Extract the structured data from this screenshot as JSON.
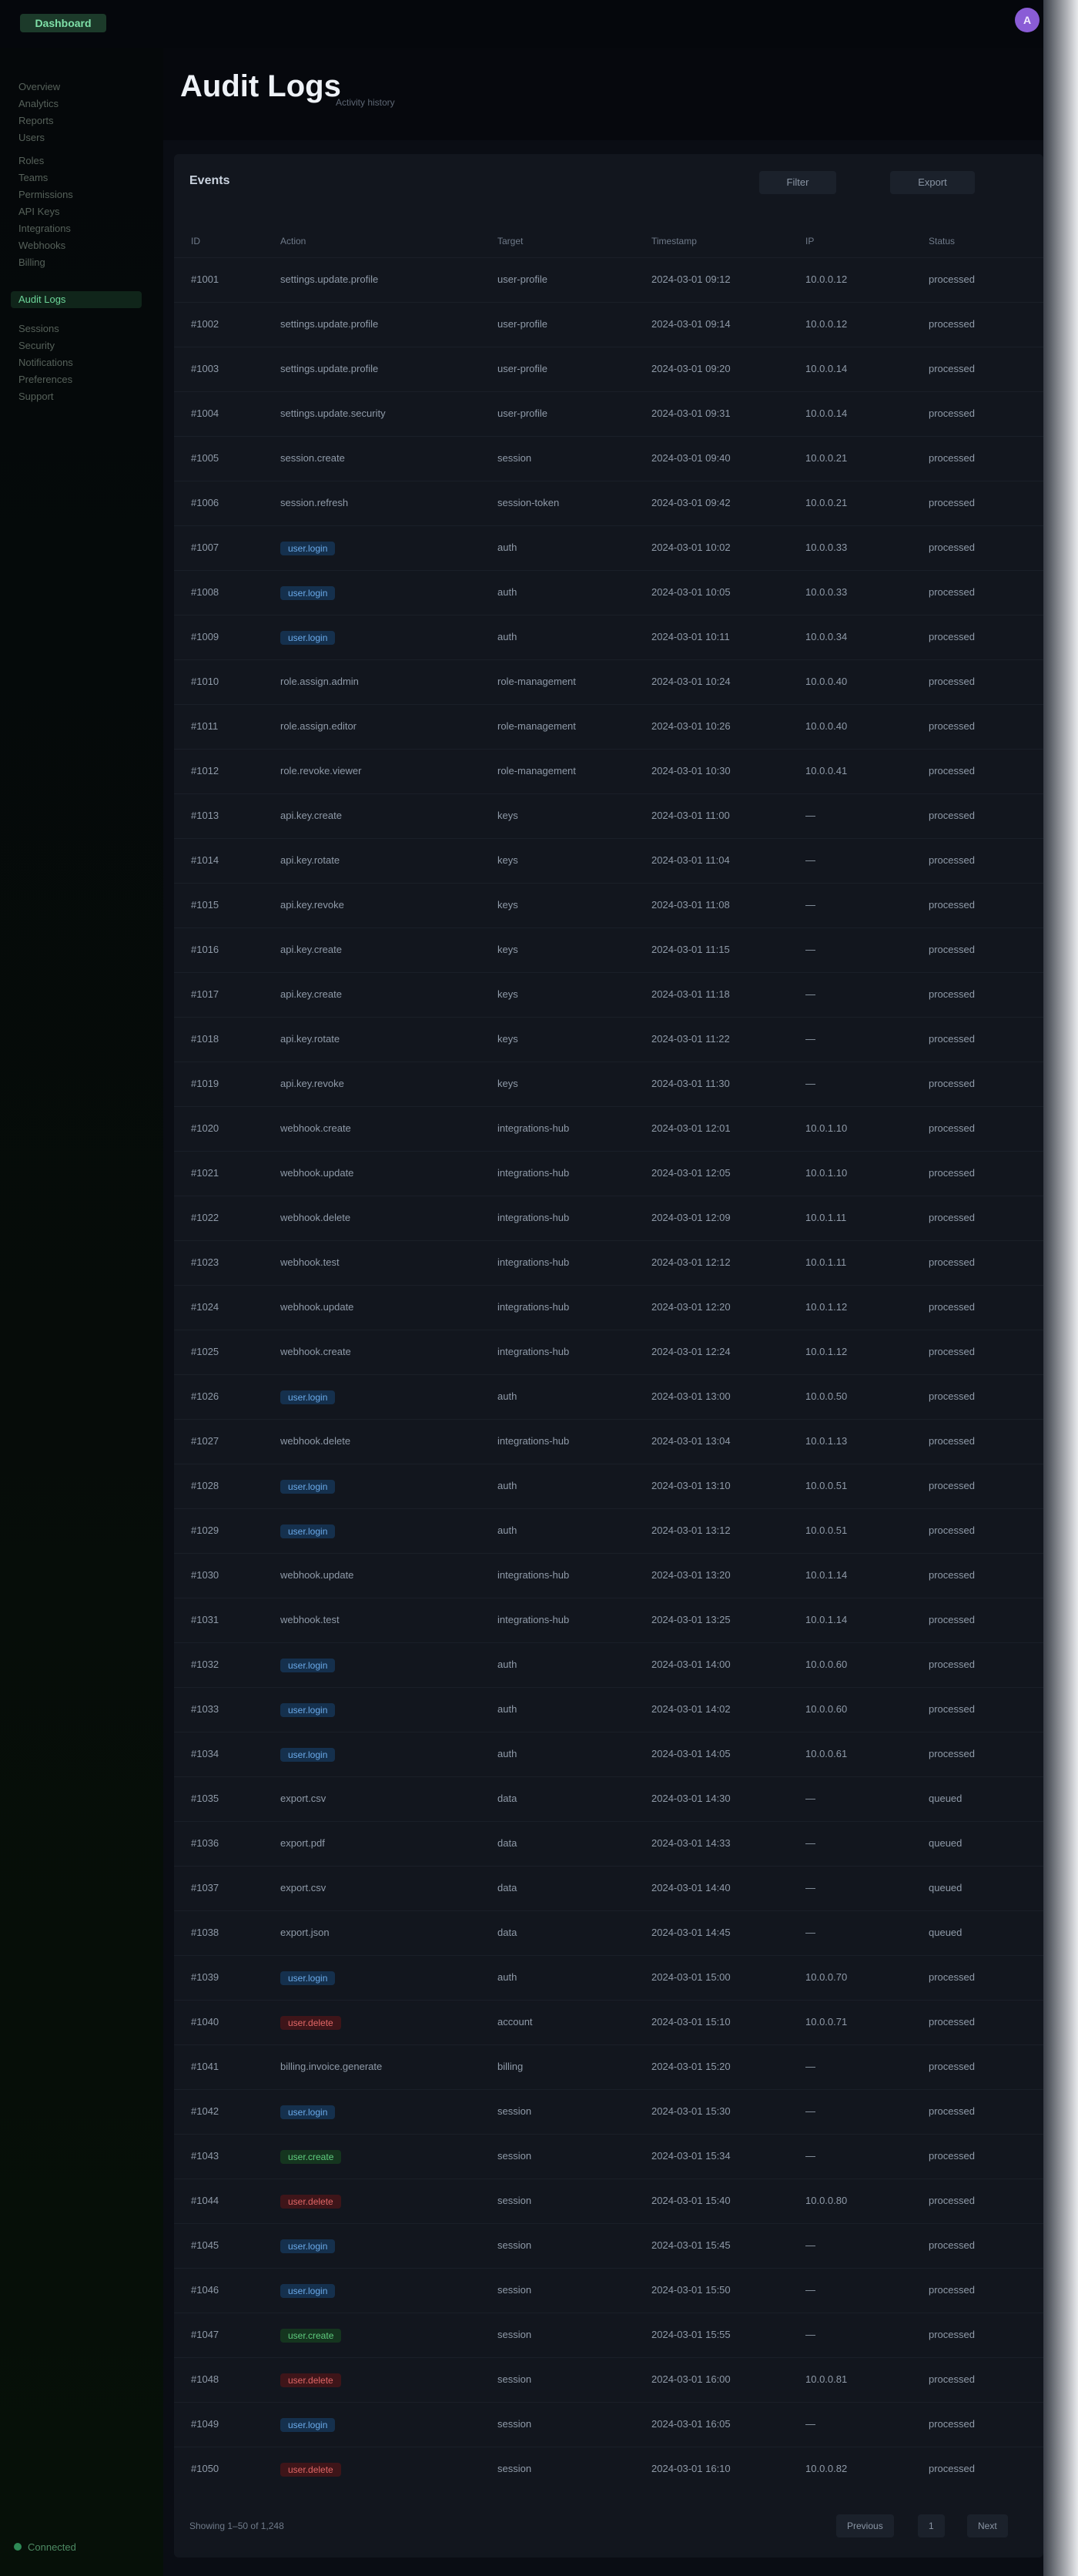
{
  "app": {
    "brand": "Dashboard",
    "avatar_initial": "A"
  },
  "sidebar": {
    "items": [
      {
        "label": "Overview"
      },
      {
        "label": "Analytics"
      },
      {
        "label": "Reports"
      },
      {
        "label": "Users"
      },
      {
        "label": "Roles"
      },
      {
        "label": "Teams"
      },
      {
        "label": "Permissions"
      },
      {
        "label": "API Keys"
      },
      {
        "label": "Integrations"
      },
      {
        "label": "Webhooks"
      },
      {
        "label": "Billing"
      },
      {
        "label": "Audit Logs",
        "active": true
      },
      {
        "label": "Sessions"
      },
      {
        "label": "Security"
      },
      {
        "label": "Notifications"
      },
      {
        "label": "Preferences"
      },
      {
        "label": "Support"
      }
    ],
    "footer_status": "Connected"
  },
  "page": {
    "title": "Audit Logs",
    "subtitle": "Activity history"
  },
  "table": {
    "title": "Events",
    "controls": {
      "filter": "Filter",
      "export": "Export"
    },
    "columns": [
      "ID",
      "Action",
      "Target",
      "Timestamp",
      "IP",
      "Status"
    ],
    "rows": [
      {
        "id": "#1001",
        "action": "settings.update.profile",
        "target": "user-profile",
        "ts": "2024-03-01 09:12",
        "ip": "10.0.0.12",
        "status": "processed",
        "kind": "plain"
      },
      {
        "id": "#1002",
        "action": "settings.update.profile",
        "target": "user-profile",
        "ts": "2024-03-01 09:14",
        "ip": "10.0.0.12",
        "status": "processed",
        "kind": "plain"
      },
      {
        "id": "#1003",
        "action": "settings.update.profile",
        "target": "user-profile",
        "ts": "2024-03-01 09:20",
        "ip": "10.0.0.14",
        "status": "processed",
        "kind": "plain"
      },
      {
        "id": "#1004",
        "action": "settings.update.security",
        "target": "user-profile",
        "ts": "2024-03-01 09:31",
        "ip": "10.0.0.14",
        "status": "processed",
        "kind": "plain"
      },
      {
        "id": "#1005",
        "action": "session.create",
        "target": "session",
        "ts": "2024-03-01 09:40",
        "ip": "10.0.0.21",
        "status": "processed",
        "kind": "plain"
      },
      {
        "id": "#1006",
        "action": "session.refresh",
        "target": "session-token",
        "ts": "2024-03-01 09:42",
        "ip": "10.0.0.21",
        "status": "processed",
        "kind": "plain"
      },
      {
        "id": "#1007",
        "action": "user.login",
        "target": "auth",
        "ts": "2024-03-01 10:02",
        "ip": "10.0.0.33",
        "status": "processed",
        "kind": "blue"
      },
      {
        "id": "#1008",
        "action": "user.login",
        "target": "auth",
        "ts": "2024-03-01 10:05",
        "ip": "10.0.0.33",
        "status": "processed",
        "kind": "blue"
      },
      {
        "id": "#1009",
        "action": "user.login",
        "target": "auth",
        "ts": "2024-03-01 10:11",
        "ip": "10.0.0.34",
        "status": "processed",
        "kind": "blue"
      },
      {
        "id": "#1010",
        "action": "role.assign.admin",
        "target": "role-management",
        "ts": "2024-03-01 10:24",
        "ip": "10.0.0.40",
        "status": "processed",
        "kind": "plain"
      },
      {
        "id": "#1011",
        "action": "role.assign.editor",
        "target": "role-management",
        "ts": "2024-03-01 10:26",
        "ip": "10.0.0.40",
        "status": "processed",
        "kind": "plain"
      },
      {
        "id": "#1012",
        "action": "role.revoke.viewer",
        "target": "role-management",
        "ts": "2024-03-01 10:30",
        "ip": "10.0.0.41",
        "status": "processed",
        "kind": "plain"
      },
      {
        "id": "#1013",
        "action": "api.key.create",
        "target": "keys",
        "ts": "2024-03-01 11:00",
        "ip": "—",
        "status": "processed",
        "kind": "plain"
      },
      {
        "id": "#1014",
        "action": "api.key.rotate",
        "target": "keys",
        "ts": "2024-03-01 11:04",
        "ip": "—",
        "status": "processed",
        "kind": "plain"
      },
      {
        "id": "#1015",
        "action": "api.key.revoke",
        "target": "keys",
        "ts": "2024-03-01 11:08",
        "ip": "—",
        "status": "processed",
        "kind": "plain"
      },
      {
        "id": "#1016",
        "action": "api.key.create",
        "target": "keys",
        "ts": "2024-03-01 11:15",
        "ip": "—",
        "status": "processed",
        "kind": "plain"
      },
      {
        "id": "#1017",
        "action": "api.key.create",
        "target": "keys",
        "ts": "2024-03-01 11:18",
        "ip": "—",
        "status": "processed",
        "kind": "plain"
      },
      {
        "id": "#1018",
        "action": "api.key.rotate",
        "target": "keys",
        "ts": "2024-03-01 11:22",
        "ip": "—",
        "status": "processed",
        "kind": "plain"
      },
      {
        "id": "#1019",
        "action": "api.key.revoke",
        "target": "keys",
        "ts": "2024-03-01 11:30",
        "ip": "—",
        "status": "processed",
        "kind": "plain"
      },
      {
        "id": "#1020",
        "action": "webhook.create",
        "target": "integrations-hub",
        "ts": "2024-03-01 12:01",
        "ip": "10.0.1.10",
        "status": "processed",
        "kind": "plain"
      },
      {
        "id": "#1021",
        "action": "webhook.update",
        "target": "integrations-hub",
        "ts": "2024-03-01 12:05",
        "ip": "10.0.1.10",
        "status": "processed",
        "kind": "plain"
      },
      {
        "id": "#1022",
        "action": "webhook.delete",
        "target": "integrations-hub",
        "ts": "2024-03-01 12:09",
        "ip": "10.0.1.11",
        "status": "processed",
        "kind": "plain"
      },
      {
        "id": "#1023",
        "action": "webhook.test",
        "target": "integrations-hub",
        "ts": "2024-03-01 12:12",
        "ip": "10.0.1.11",
        "status": "processed",
        "kind": "plain"
      },
      {
        "id": "#1024",
        "action": "webhook.update",
        "target": "integrations-hub",
        "ts": "2024-03-01 12:20",
        "ip": "10.0.1.12",
        "status": "processed",
        "kind": "plain"
      },
      {
        "id": "#1025",
        "action": "webhook.create",
        "target": "integrations-hub",
        "ts": "2024-03-01 12:24",
        "ip": "10.0.1.12",
        "status": "processed",
        "kind": "plain"
      },
      {
        "id": "#1026",
        "action": "user.login",
        "target": "auth",
        "ts": "2024-03-01 13:00",
        "ip": "10.0.0.50",
        "status": "processed",
        "kind": "blue"
      },
      {
        "id": "#1027",
        "action": "webhook.delete",
        "target": "integrations-hub",
        "ts": "2024-03-01 13:04",
        "ip": "10.0.1.13",
        "status": "processed",
        "kind": "plain"
      },
      {
        "id": "#1028",
        "action": "user.login",
        "target": "auth",
        "ts": "2024-03-01 13:10",
        "ip": "10.0.0.51",
        "status": "processed",
        "kind": "blue"
      },
      {
        "id": "#1029",
        "action": "user.login",
        "target": "auth",
        "ts": "2024-03-01 13:12",
        "ip": "10.0.0.51",
        "status": "processed",
        "kind": "blue"
      },
      {
        "id": "#1030",
        "action": "webhook.update",
        "target": "integrations-hub",
        "ts": "2024-03-01 13:20",
        "ip": "10.0.1.14",
        "status": "processed",
        "kind": "plain"
      },
      {
        "id": "#1031",
        "action": "webhook.test",
        "target": "integrations-hub",
        "ts": "2024-03-01 13:25",
        "ip": "10.0.1.14",
        "status": "processed",
        "kind": "plain"
      },
      {
        "id": "#1032",
        "action": "user.login",
        "target": "auth",
        "ts": "2024-03-01 14:00",
        "ip": "10.0.0.60",
        "status": "processed",
        "kind": "blue"
      },
      {
        "id": "#1033",
        "action": "user.login",
        "target": "auth",
        "ts": "2024-03-01 14:02",
        "ip": "10.0.0.60",
        "status": "processed",
        "kind": "blue"
      },
      {
        "id": "#1034",
        "action": "user.login",
        "target": "auth",
        "ts": "2024-03-01 14:05",
        "ip": "10.0.0.61",
        "status": "processed",
        "kind": "blue"
      },
      {
        "id": "#1035",
        "action": "export.csv",
        "target": "data",
        "ts": "2024-03-01 14:30",
        "ip": "—",
        "status": "queued",
        "kind": "plain"
      },
      {
        "id": "#1036",
        "action": "export.pdf",
        "target": "data",
        "ts": "2024-03-01 14:33",
        "ip": "—",
        "status": "queued",
        "kind": "plain"
      },
      {
        "id": "#1037",
        "action": "export.csv",
        "target": "data",
        "ts": "2024-03-01 14:40",
        "ip": "—",
        "status": "queued",
        "kind": "plain"
      },
      {
        "id": "#1038",
        "action": "export.json",
        "target": "data",
        "ts": "2024-03-01 14:45",
        "ip": "—",
        "status": "queued",
        "kind": "plain"
      },
      {
        "id": "#1039",
        "action": "user.login",
        "target": "auth",
        "ts": "2024-03-01 15:00",
        "ip": "10.0.0.70",
        "status": "processed",
        "kind": "blue"
      },
      {
        "id": "#1040",
        "action": "user.delete",
        "target": "account",
        "ts": "2024-03-01 15:10",
        "ip": "10.0.0.71",
        "status": "processed",
        "kind": "red"
      },
      {
        "id": "#1041",
        "action": "billing.invoice.generate",
        "target": "billing",
        "ts": "2024-03-01 15:20",
        "ip": "—",
        "status": "processed",
        "kind": "plain"
      },
      {
        "id": "#1042",
        "action": "user.login",
        "target": "session",
        "ts": "2024-03-01 15:30",
        "ip": "—",
        "status": "processed",
        "kind": "blue"
      },
      {
        "id": "#1043",
        "action": "user.create",
        "target": "session",
        "ts": "2024-03-01 15:34",
        "ip": "—",
        "status": "processed",
        "kind": "green"
      },
      {
        "id": "#1044",
        "action": "user.delete",
        "target": "session",
        "ts": "2024-03-01 15:40",
        "ip": "10.0.0.80",
        "status": "processed",
        "kind": "red"
      },
      {
        "id": "#1045",
        "action": "user.login",
        "target": "session",
        "ts": "2024-03-01 15:45",
        "ip": "—",
        "status": "processed",
        "kind": "blue"
      },
      {
        "id": "#1046",
        "action": "user.login",
        "target": "session",
        "ts": "2024-03-01 15:50",
        "ip": "—",
        "status": "processed",
        "kind": "blue"
      },
      {
        "id": "#1047",
        "action": "user.create",
        "target": "session",
        "ts": "2024-03-01 15:55",
        "ip": "—",
        "status": "processed",
        "kind": "green"
      },
      {
        "id": "#1048",
        "action": "user.delete",
        "target": "session",
        "ts": "2024-03-01 16:00",
        "ip": "10.0.0.81",
        "status": "processed",
        "kind": "red"
      },
      {
        "id": "#1049",
        "action": "user.login",
        "target": "session",
        "ts": "2024-03-01 16:05",
        "ip": "—",
        "status": "processed",
        "kind": "blue"
      },
      {
        "id": "#1050",
        "action": "user.delete",
        "target": "session",
        "ts": "2024-03-01 16:10",
        "ip": "10.0.0.82",
        "status": "processed",
        "kind": "red"
      }
    ],
    "footer": {
      "summary": "Showing 1–50 of 1,248",
      "prev": "Previous",
      "page": "1",
      "next": "Next"
    }
  },
  "colors": {
    "accent": "#6dd69a",
    "badge_blue": "#6aa9e8",
    "badge_green": "#5fcb7e",
    "badge_red": "#e06666"
  }
}
